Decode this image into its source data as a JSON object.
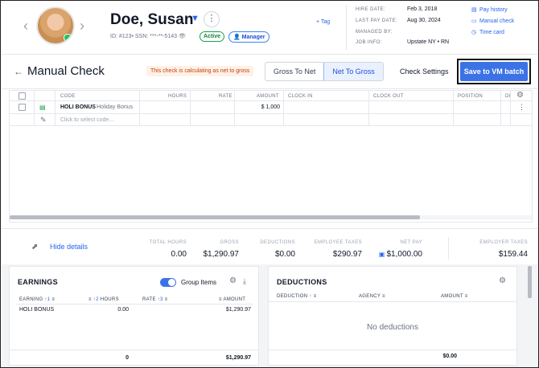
{
  "header": {
    "name": "Doe, Susan",
    "id_line": "ID: #123• SSN: ***-**-5143 👁",
    "status_badge": "Active",
    "role_badge": "Manager",
    "tag_link": "+ Tag",
    "info": [
      {
        "key": "HIRE DATE:",
        "value": "Feb 3, 2018"
      },
      {
        "key": "LAST PAY DATE:",
        "value": "Aug 30, 2024"
      },
      {
        "key": "MANAGED BY:",
        "value": ""
      },
      {
        "key": "JOB INFO:",
        "value": "Upstate NY • RN"
      }
    ],
    "quick_links": [
      {
        "label": "Pay history",
        "icon": "history-icon"
      },
      {
        "label": "Manual check",
        "icon": "check-icon"
      },
      {
        "label": "Time card",
        "icon": "clock-icon"
      }
    ]
  },
  "action_bar": {
    "title": "Manual Check",
    "warning": "This check is calculating as net to gross",
    "mode_options": [
      "Gross To Net",
      "Net To Gross"
    ],
    "mode_selected": "Net To Gross",
    "check_settings": "Check Settings",
    "save_button": "Save to VM batch"
  },
  "grid": {
    "columns": [
      "CODE",
      "HOURS",
      "RATE",
      "AMOUNT",
      "CLOCK IN",
      "CLOCK OUT",
      "POSITION",
      "DI"
    ],
    "rows": [
      {
        "code": "HOLI BONUS",
        "code_desc": "Holiday Bonus",
        "hours": "",
        "rate": "",
        "amount": "$ 1,000",
        "clock_in": "",
        "clock_out": "",
        "position": ""
      }
    ],
    "new_row_placeholder": "Click to select code..."
  },
  "totals": {
    "hide_details": "Hide details",
    "items": [
      {
        "label": "TOTAL HOURS",
        "value": "0.00"
      },
      {
        "label": "GROSS",
        "value": "$1,290.97"
      },
      {
        "label": "DEDUCTIONS",
        "value": "$0.00"
      },
      {
        "label": "EMPLOYEE TAXES",
        "value": "$290.97"
      },
      {
        "label": "NET PAY",
        "value": "$1,000.00"
      },
      {
        "label": "EMPLOYER TAXES",
        "value": "$159.44"
      }
    ]
  },
  "earnings": {
    "title": "EARNINGS",
    "group_items_label": "Group Items",
    "group_items_on": true,
    "headers": [
      "EARNING",
      "1",
      "2",
      "HOURS",
      "RATE",
      "3",
      "AMOUNT"
    ],
    "rows": [
      {
        "earning": "HOLI BONUS",
        "hours": "0.00",
        "rate": "",
        "amount": "$1,290.97"
      }
    ],
    "footer_hours": "0",
    "footer_amount": "$1,290.97"
  },
  "deductions": {
    "title": "DEDUCTIONS",
    "headers": [
      "DEDUCTION",
      "AGENCY",
      "AMOUNT"
    ],
    "empty_text": "No deductions",
    "footer_amount": "$0.00"
  }
}
